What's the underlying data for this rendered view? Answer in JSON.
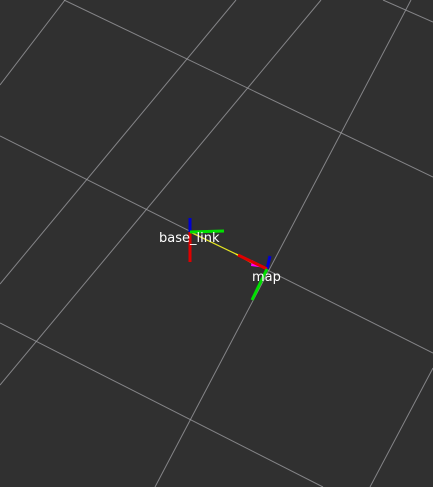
{
  "viewport": {
    "background_color": "#303030",
    "grid_color": "#a0a0a4"
  },
  "frames": [
    {
      "name": "base_link",
      "label": "base_link"
    },
    {
      "name": "map",
      "label": "map"
    }
  ],
  "axis_colors": {
    "x": "#e00000",
    "y": "#00e000",
    "z": "#0000d0"
  },
  "tf_link": {
    "parent": "map",
    "child": "base_link",
    "colors": [
      "#ffff00",
      "#ff00ff"
    ]
  }
}
